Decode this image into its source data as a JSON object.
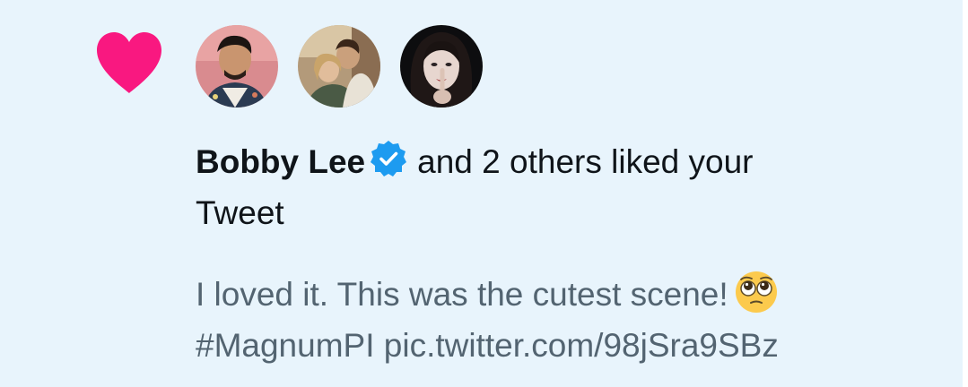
{
  "colors": {
    "background": "#e8f4fc",
    "heart": "#f91880",
    "verified": "#1d9bf0",
    "primary_text": "#0f1419",
    "secondary_text": "#536471"
  },
  "icons": {
    "type": "heart-icon",
    "badge": "verified-badge-icon",
    "emoji": "pleading-face-emoji"
  },
  "notification": {
    "liker_name": "Bobby Lee",
    "action_text": "and 2 others liked your",
    "action_object": "Tweet",
    "tweet_text": "I loved it. This was the cutest scene!",
    "tweet_hashtag": "#MagnumPI",
    "tweet_link": "pic.twitter.com/98jSra9SBz",
    "avatars": [
      {
        "name": "avatar-1"
      },
      {
        "name": "avatar-2"
      },
      {
        "name": "avatar-3"
      }
    ]
  }
}
